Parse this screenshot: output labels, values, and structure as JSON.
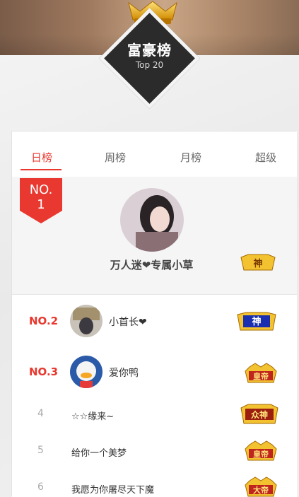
{
  "header": {
    "title": "富豪榜",
    "subtitle": "Top 20"
  },
  "tabs": [
    {
      "label": "日榜",
      "active": true
    },
    {
      "label": "周榜",
      "active": false
    },
    {
      "label": "月榜",
      "active": false
    },
    {
      "label": "超级",
      "active": false
    }
  ],
  "colors": {
    "accent": "#e8382f",
    "diamond": "#2b2b2b",
    "gold": "#f4b400"
  },
  "first": {
    "rank_line1": "NO.",
    "rank_line2": "1",
    "name": "万人迷❤专属小草",
    "badge": "神"
  },
  "ranking": [
    {
      "rank": "NO.2",
      "name": "小首长❤",
      "badge": "神"
    },
    {
      "rank": "NO.3",
      "name": "爱你鸭",
      "badge": "皇帝"
    },
    {
      "rank": "4",
      "name": "☆☆缘来~",
      "badge": "众神"
    },
    {
      "rank": "5",
      "name": "给你一个美梦",
      "badge": "皇帝"
    },
    {
      "rank": "6",
      "name": "我愿为你屠尽天下魔",
      "badge": "大帝"
    }
  ]
}
